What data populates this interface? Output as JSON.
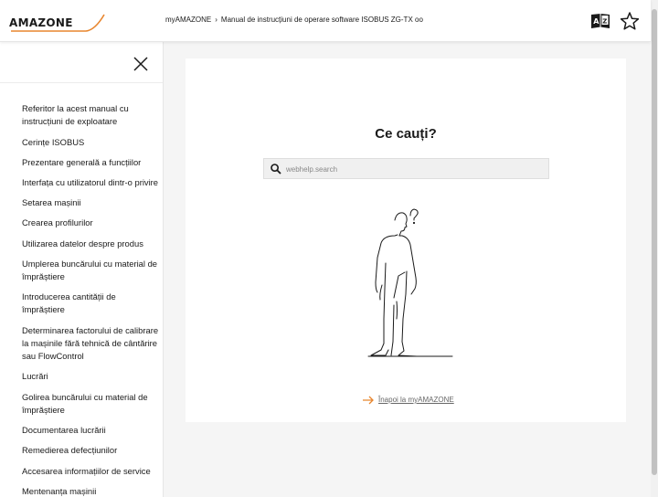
{
  "header": {
    "logo_text": "AMAZONE",
    "breadcrumb": {
      "root": "myAMAZONE",
      "separator": "›",
      "current": "Manual de instrucțiuni de operare software ISOBUS ZG-TX oo"
    },
    "icons": [
      "book-language-icon",
      "star-icon"
    ]
  },
  "sidebar": {
    "close_icon": "close-icon",
    "items": [
      {
        "label": "Referitor la acest manual cu instrucțiuni de exploatare"
      },
      {
        "label": "Cerințe ISOBUS"
      },
      {
        "label": "Prezentare generală a funcțiilor"
      },
      {
        "label": "Interfața cu utilizatorul dintr-o privire"
      },
      {
        "label": "Setarea mașinii"
      },
      {
        "label": "Crearea profilurilor"
      },
      {
        "label": "Utilizarea datelor despre produs"
      },
      {
        "label": "Umplerea buncărului cu material de împrăștiere"
      },
      {
        "label": "Introducerea cantității de împrăștiere"
      },
      {
        "label": "Determinarea factorului de calibrare la mașinile fără tehnică de cântărire sau FlowControl"
      },
      {
        "label": "Lucrări"
      },
      {
        "label": "Golirea buncărului cu material de împrăștiere"
      },
      {
        "label": "Documentarea lucrării"
      },
      {
        "label": "Remedierea defecțiunilor"
      },
      {
        "label": "Accesarea informațiilor de service"
      },
      {
        "label": "Mentenanța mașinii"
      }
    ]
  },
  "main": {
    "title": "Ce cauți?",
    "search": {
      "placeholder": "webhelp.search",
      "value": "",
      "icon": "search-icon"
    },
    "back_link": {
      "label": "Înapoi la myAMAZONE",
      "icon": "arrow-right-icon"
    }
  },
  "colors": {
    "accent": "#e8862e",
    "text": "#1a1a1a",
    "page_bg": "#f5f5f5"
  }
}
